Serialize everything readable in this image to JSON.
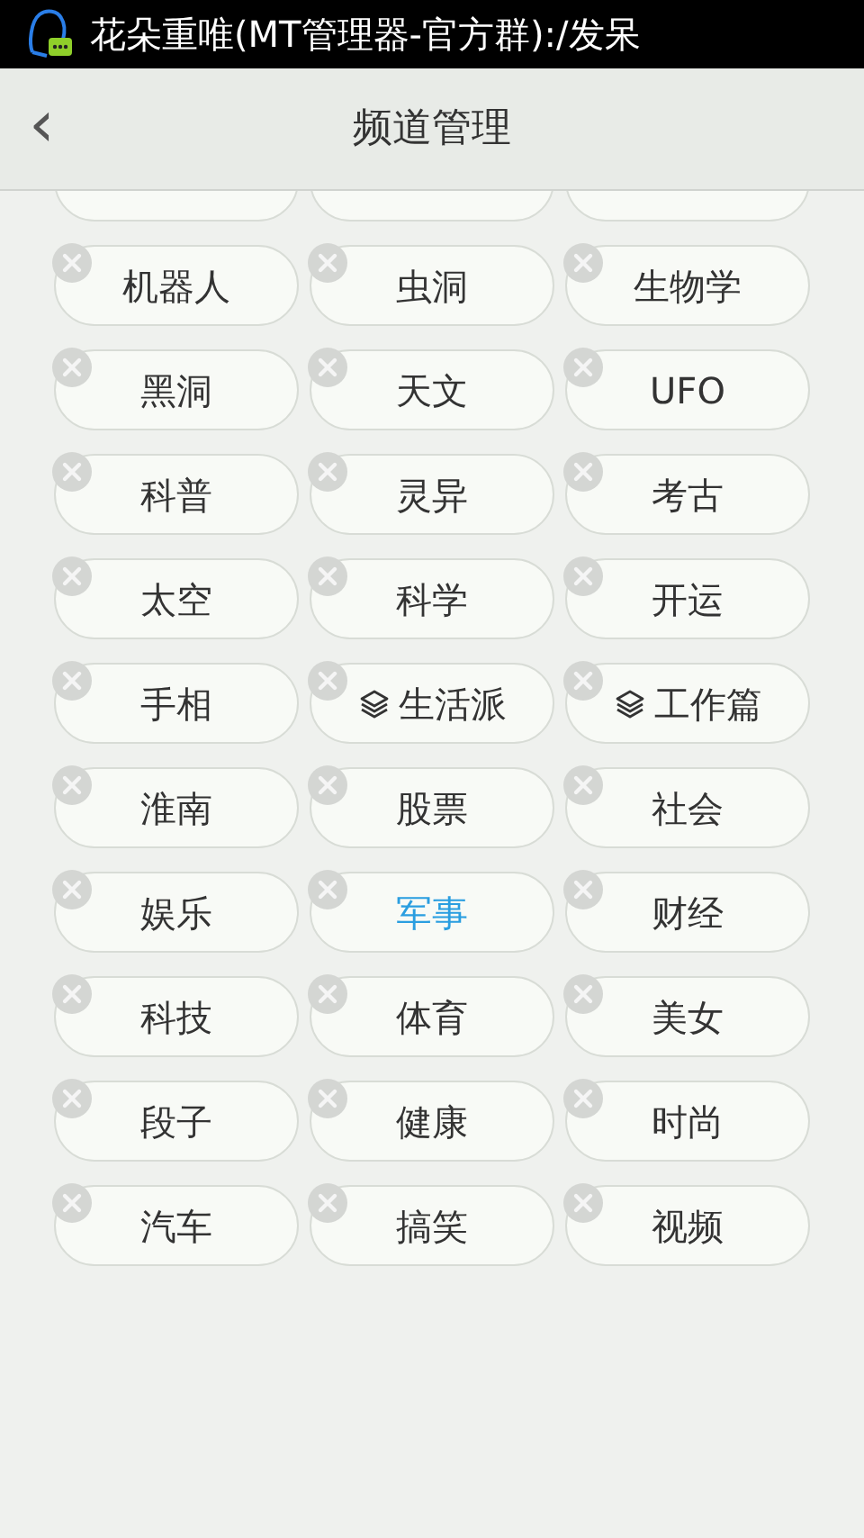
{
  "status_bar": {
    "notification": "花朵重唯(MT管理器-官方群):/发呆"
  },
  "header": {
    "back": "‹",
    "title": "频道管理"
  },
  "channels": [
    {
      "label": "机器人",
      "kind": "plain",
      "selected": false
    },
    {
      "label": "虫洞",
      "kind": "plain",
      "selected": false
    },
    {
      "label": "生物学",
      "kind": "plain",
      "selected": false
    },
    {
      "label": "黑洞",
      "kind": "plain",
      "selected": false
    },
    {
      "label": "天文",
      "kind": "plain",
      "selected": false
    },
    {
      "label": "UFO",
      "kind": "plain",
      "selected": false
    },
    {
      "label": "科普",
      "kind": "plain",
      "selected": false
    },
    {
      "label": "灵异",
      "kind": "plain",
      "selected": false
    },
    {
      "label": "考古",
      "kind": "plain",
      "selected": false
    },
    {
      "label": "太空",
      "kind": "plain",
      "selected": false
    },
    {
      "label": "科学",
      "kind": "plain",
      "selected": false
    },
    {
      "label": "开运",
      "kind": "plain",
      "selected": false
    },
    {
      "label": "手相",
      "kind": "plain",
      "selected": false
    },
    {
      "label": "生活派",
      "kind": "group",
      "selected": false
    },
    {
      "label": "工作篇",
      "kind": "group",
      "selected": false
    },
    {
      "label": "淮南",
      "kind": "plain",
      "selected": false
    },
    {
      "label": "股票",
      "kind": "plain",
      "selected": false
    },
    {
      "label": "社会",
      "kind": "plain",
      "selected": false
    },
    {
      "label": "娱乐",
      "kind": "plain",
      "selected": false
    },
    {
      "label": "军事",
      "kind": "plain",
      "selected": true
    },
    {
      "label": "财经",
      "kind": "plain",
      "selected": false
    },
    {
      "label": "科技",
      "kind": "plain",
      "selected": false
    },
    {
      "label": "体育",
      "kind": "plain",
      "selected": false
    },
    {
      "label": "美女",
      "kind": "plain",
      "selected": false
    },
    {
      "label": "段子",
      "kind": "plain",
      "selected": false
    },
    {
      "label": "健康",
      "kind": "plain",
      "selected": false
    },
    {
      "label": "时尚",
      "kind": "plain",
      "selected": false
    },
    {
      "label": "汽车",
      "kind": "plain",
      "selected": false
    },
    {
      "label": "搞笑",
      "kind": "plain",
      "selected": false
    },
    {
      "label": "视频",
      "kind": "plain",
      "selected": false
    }
  ]
}
